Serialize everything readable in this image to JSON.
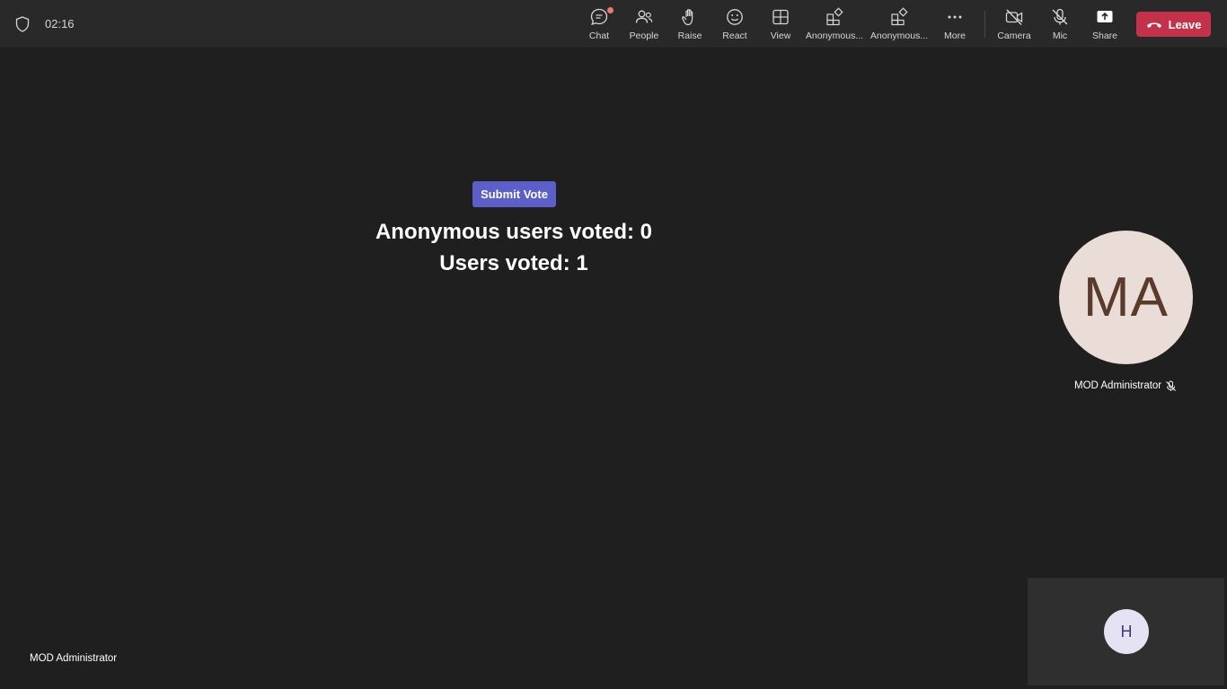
{
  "meeting": {
    "timer": "02:16"
  },
  "toolbar": {
    "items": [
      {
        "id": "chat",
        "label": "Chat"
      },
      {
        "id": "people",
        "label": "People"
      },
      {
        "id": "raise",
        "label": "Raise"
      },
      {
        "id": "react",
        "label": "React"
      },
      {
        "id": "view",
        "label": "View"
      },
      {
        "id": "app1",
        "label": "Anonymous..."
      },
      {
        "id": "app2",
        "label": "Anonymous..."
      },
      {
        "id": "more",
        "label": "More"
      },
      {
        "id": "camera",
        "label": "Camera"
      },
      {
        "id": "mic",
        "label": "Mic"
      },
      {
        "id": "share",
        "label": "Share"
      }
    ],
    "leave_label": "Leave",
    "leave_color": "#c4314b"
  },
  "stage": {
    "submit_label": "Submit Vote",
    "submit_color": "#5b5fc7",
    "anonymous_result": "Anonymous users voted: 0",
    "users_result": "Users voted: 1",
    "presenter_name": "MOD Administrator"
  },
  "participants": {
    "main": {
      "initials": "MA",
      "name": "MOD Administrator",
      "muted": true,
      "avatar_color": "#eadcd7"
    },
    "self": {
      "initials": "H",
      "avatar_color": "#e5e3f3"
    }
  }
}
